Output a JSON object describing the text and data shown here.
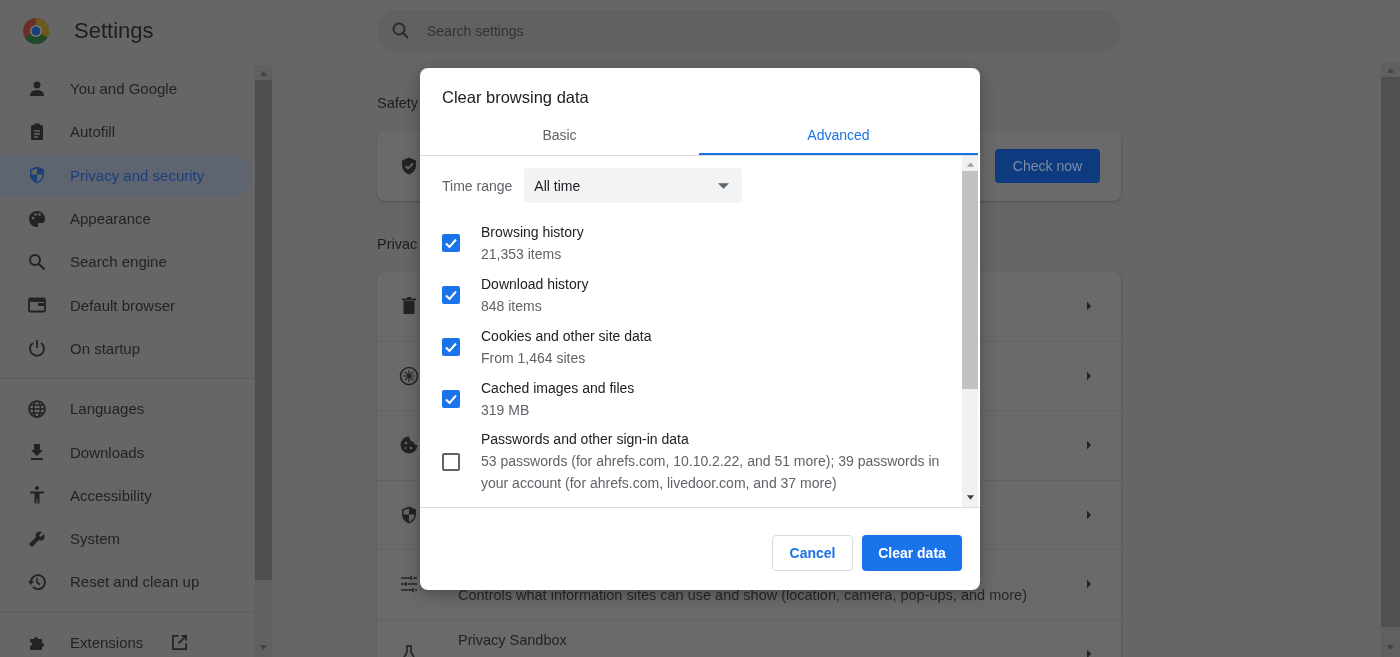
{
  "header": {
    "title": "Settings",
    "search": {
      "placeholder": "Search settings"
    }
  },
  "sidebar": {
    "sections": [
      {
        "items": [
          {
            "label": "You and Google",
            "selected": false
          },
          {
            "label": "Autofill",
            "selected": false
          },
          {
            "label": "Privacy and security",
            "selected": true
          },
          {
            "label": "Appearance",
            "selected": false
          },
          {
            "label": "Search engine",
            "selected": false
          },
          {
            "label": "Default browser",
            "selected": false
          },
          {
            "label": "On startup",
            "selected": false
          }
        ]
      },
      {
        "items": [
          {
            "label": "Languages",
            "selected": false
          },
          {
            "label": "Downloads",
            "selected": false
          },
          {
            "label": "Accessibility",
            "selected": false
          },
          {
            "label": "System",
            "selected": false
          },
          {
            "label": "Reset and clean up",
            "selected": false
          }
        ]
      },
      {
        "items": [
          {
            "label": "Extensions",
            "selected": false,
            "kind": "external"
          }
        ]
      }
    ]
  },
  "safety_check": {
    "heading": "Safety",
    "button": "Check now"
  },
  "privacy": {
    "heading": "Privac",
    "rows": [
      {},
      {},
      {},
      {},
      {
        "subtitle": "Controls what information sites can use and show (location, camera, pop-ups, and more)"
      },
      {
        "title": "Privacy Sandbox"
      }
    ]
  },
  "dialog": {
    "title": "Clear browsing data",
    "tabs": [
      {
        "label": "Basic",
        "selected": false
      },
      {
        "label": "Advanced",
        "selected": true
      }
    ],
    "time_range": {
      "label": "Time range",
      "value": "All time"
    },
    "items": [
      {
        "label": "Browsing history",
        "detail": "21,353 items",
        "checked": true
      },
      {
        "label": "Download history",
        "detail": "848 items",
        "checked": true
      },
      {
        "label": "Cookies and other site data",
        "detail": "From 1,464 sites",
        "checked": true
      },
      {
        "label": "Cached images and files",
        "detail": "319 MB",
        "checked": true
      },
      {
        "label": "Passwords and other sign-in data",
        "detail": "53 passwords (for ahrefs.com, 10.10.2.22, and 51 more); 39 passwords in your account (for ahrefs.com, livedoor.com, and 37 more)",
        "checked": false
      }
    ],
    "buttons": [
      {
        "label": "Cancel",
        "kind": "secondary"
      },
      {
        "label": "Clear data",
        "kind": "primary"
      }
    ]
  }
}
